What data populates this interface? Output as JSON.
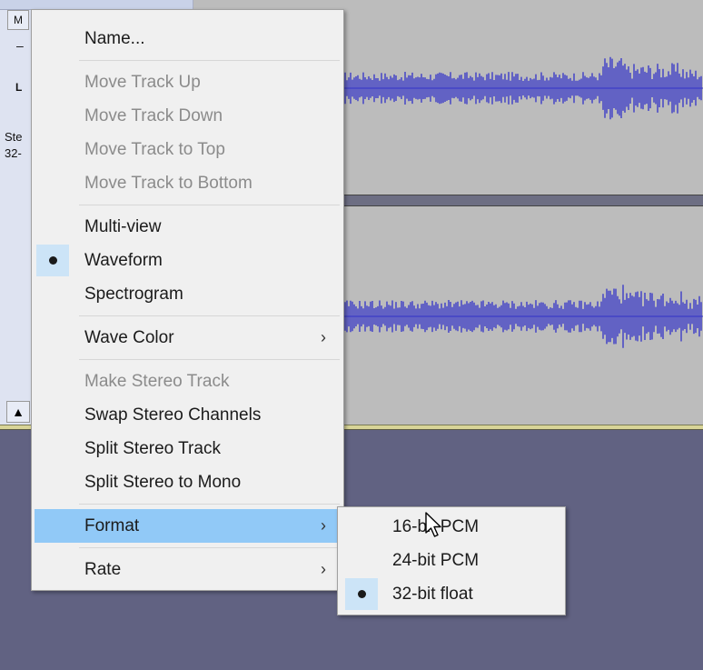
{
  "track_panel": {
    "mute_label": "M",
    "gain_minus": "–",
    "pan_left": "L",
    "track_info_line1": "Ste",
    "track_info_line2": "32-",
    "collapse_icon": "▲"
  },
  "context_menu": {
    "items": [
      {
        "label": "Name...",
        "enabled": true
      },
      {
        "label": "Move Track Up",
        "enabled": false
      },
      {
        "label": "Move Track Down",
        "enabled": false
      },
      {
        "label": "Move Track to Top",
        "enabled": false
      },
      {
        "label": "Move Track to Bottom",
        "enabled": false
      },
      {
        "label": "Multi-view",
        "enabled": true
      },
      {
        "label": "Waveform",
        "enabled": true,
        "checked": true
      },
      {
        "label": "Spectrogram",
        "enabled": true
      },
      {
        "label": "Wave Color",
        "enabled": true,
        "submenu": true
      },
      {
        "label": "Make Stereo Track",
        "enabled": false
      },
      {
        "label": "Swap Stereo Channels",
        "enabled": true
      },
      {
        "label": "Split Stereo Track",
        "enabled": true
      },
      {
        "label": "Split Stereo to Mono",
        "enabled": true
      },
      {
        "label": "Format",
        "enabled": true,
        "submenu": true,
        "highlighted": true
      },
      {
        "label": "Rate",
        "enabled": true,
        "submenu": true
      }
    ],
    "submenu_arrow": "›"
  },
  "format_submenu": {
    "items": [
      {
        "label": "16-bit PCM",
        "checked": false
      },
      {
        "label": "24-bit PCM",
        "checked": false
      },
      {
        "label": "32-bit float",
        "checked": true
      }
    ]
  },
  "colors": {
    "waveform": "#3232c8",
    "menu_highlight": "#91c9f7",
    "check_background": "#cce4f7",
    "workspace": "#616282"
  }
}
